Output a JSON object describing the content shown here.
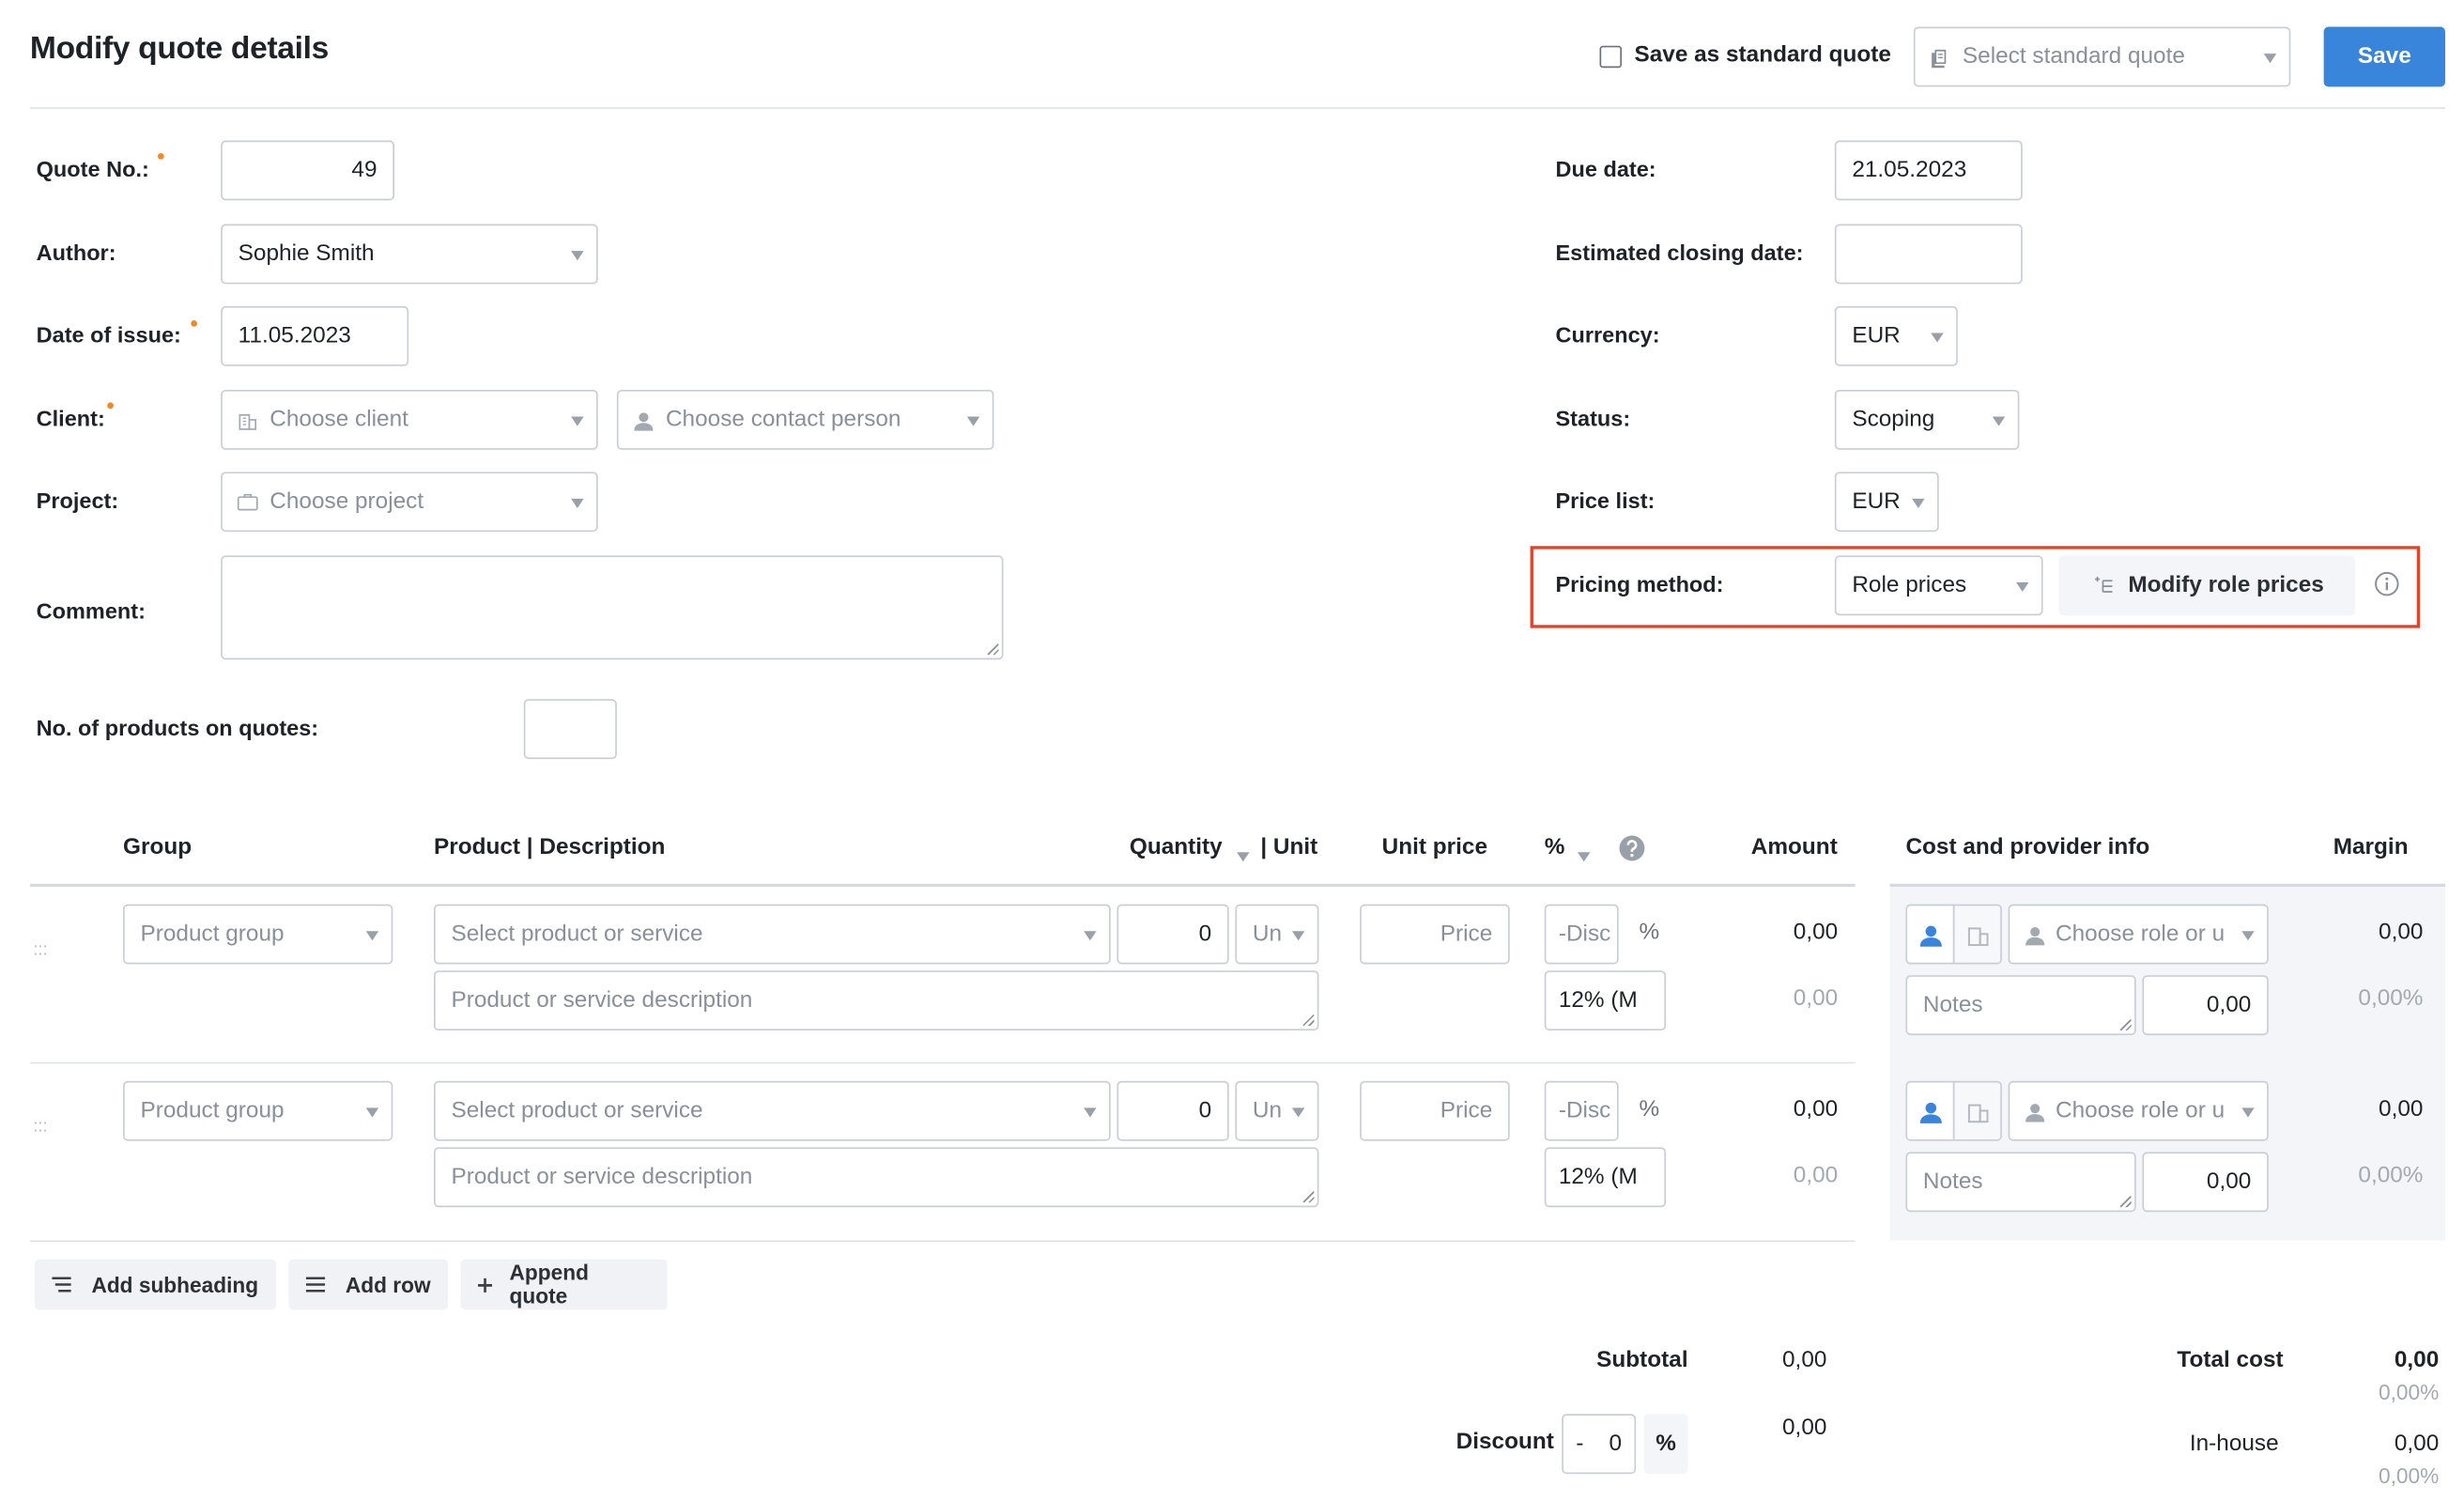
{
  "header": {
    "title": "Modify quote details",
    "save_as_standard_label": "Save as standard quote",
    "select_standard_placeholder": "Select standard quote",
    "save_label": "Save"
  },
  "form": {
    "quote_no_label": "Quote No.:",
    "quote_no_value": "49",
    "author_label": "Author:",
    "author_value": "Sophie Smith",
    "date_of_issue_label": "Date of issue:",
    "date_of_issue_value": "11.05.2023",
    "client_label": "Client:",
    "client_placeholder": "Choose client",
    "contact_placeholder": "Choose contact person",
    "project_label": "Project:",
    "project_placeholder": "Choose project",
    "comment_label": "Comment:",
    "products_label": "No. of products on quotes:",
    "due_date_label": "Due date:",
    "due_date_value": "21.05.2023",
    "closing_date_label": "Estimated closing date:",
    "currency_label": "Currency:",
    "currency_value": "EUR",
    "status_label": "Status:",
    "status_value": "Scoping",
    "price_list_label": "Price list:",
    "price_list_value": "EUR",
    "pricing_method_label": "Pricing method:",
    "pricing_method_value": "Role prices",
    "modify_role_prices_label": "Modify role prices"
  },
  "table": {
    "headers": {
      "group": "Group",
      "product": "Product | Description",
      "quantity": "Quantity",
      "unit": "| Unit",
      "unit_price": "Unit price",
      "percent": "%",
      "amount": "Amount",
      "cost_info": "Cost and provider info",
      "margin": "Margin"
    },
    "rows": [
      {
        "group_placeholder": "Product group",
        "product_placeholder": "Select product or service",
        "description_placeholder": "Product or service description",
        "quantity": "0",
        "unit_placeholder": "Un",
        "price_placeholder": "Price",
        "discount_placeholder": "-Disc",
        "percent_sign": "%",
        "vat": "12% (M",
        "amount": "0,00",
        "amount_secondary": "0,00",
        "role_placeholder": "Choose role or u",
        "notes_placeholder": "Notes",
        "cost": "0,00",
        "margin": "0,00",
        "margin_pct": "0,00%"
      },
      {
        "group_placeholder": "Product group",
        "product_placeholder": "Select product or service",
        "description_placeholder": "Product or service description",
        "quantity": "0",
        "unit_placeholder": "Un",
        "price_placeholder": "Price",
        "discount_placeholder": "-Disc",
        "percent_sign": "%",
        "vat": "12% (M",
        "amount": "0,00",
        "amount_secondary": "0,00",
        "role_placeholder": "Choose role or u",
        "notes_placeholder": "Notes",
        "cost": "0,00",
        "margin": "0,00",
        "margin_pct": "0,00%"
      }
    ]
  },
  "actions": {
    "add_subheading": "Add subheading",
    "add_row": "Add row",
    "append_quote": "Append quote"
  },
  "totals": {
    "subtotal_label": "Subtotal",
    "subtotal_value": "0,00",
    "discount_label": "Discount",
    "discount_sign": "-",
    "discount_value": "0",
    "discount_pct": "%",
    "discount_total": "0,00",
    "total_cost_label": "Total cost",
    "total_cost_value": "0,00",
    "total_cost_pct": "0,00%",
    "inhouse_label": "In-house",
    "inhouse_value": "0,00",
    "inhouse_pct": "0,00%"
  },
  "colors": {
    "accent": "#3a85dc",
    "required_dot": "#f08a24",
    "highlight": "#e0442b",
    "role_icon": "#3a85dc"
  }
}
